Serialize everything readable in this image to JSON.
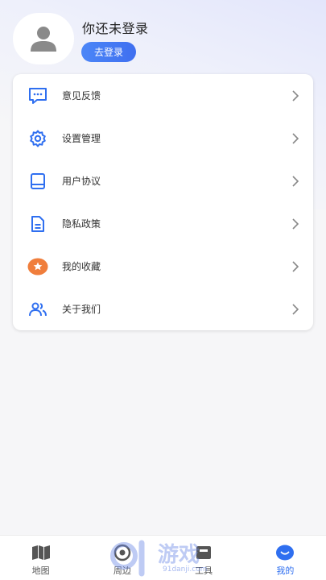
{
  "profile": {
    "username": "你还未登录",
    "login_label": "去登录"
  },
  "menu": [
    {
      "label": "意见反馈",
      "icon": "message-icon"
    },
    {
      "label": "设置管理",
      "icon": "gear-icon"
    },
    {
      "label": "用户协议",
      "icon": "book-icon"
    },
    {
      "label": "隐私政策",
      "icon": "document-icon"
    },
    {
      "label": "我的收藏",
      "icon": "star-icon"
    },
    {
      "label": "关于我们",
      "icon": "users-icon"
    }
  ],
  "tabbar": [
    {
      "label": "地图",
      "icon": "map-icon"
    },
    {
      "label": "周边",
      "icon": "nearby-icon"
    },
    {
      "label": "工具",
      "icon": "tools-icon"
    },
    {
      "label": "我的",
      "icon": "profile-smile-icon",
      "active": true
    }
  ],
  "watermark": {
    "text": "游戏",
    "domain": "91danji.com"
  },
  "colors": {
    "accent": "#2f6ff0",
    "orange": "#f07e3c",
    "background": "#f6f6f8"
  }
}
